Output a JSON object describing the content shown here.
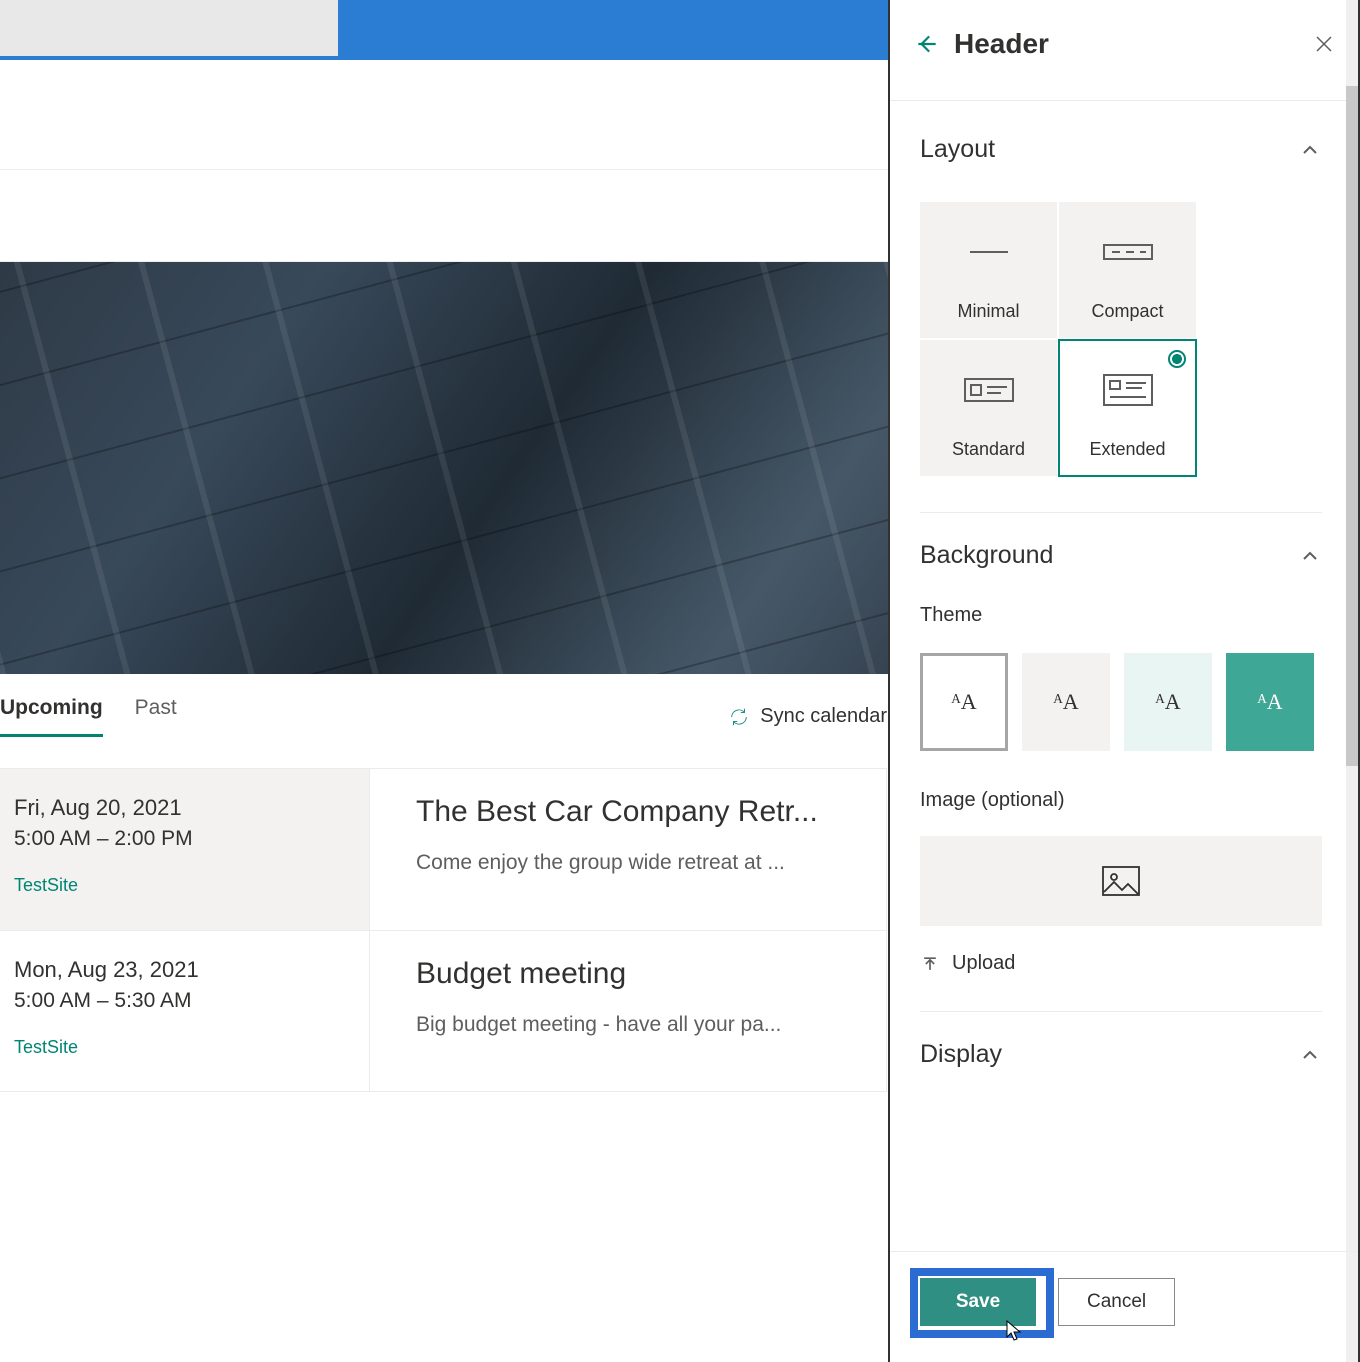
{
  "topbar": {
    "search_placeholder": ""
  },
  "tabs": {
    "upcoming": "Upcoming",
    "past": "Past"
  },
  "sync_label": "Sync calendar",
  "events": [
    {
      "date": "Fri, Aug 20, 2021",
      "time": "5:00 AM – 2:00 PM",
      "site": "TestSite",
      "title": "The Best Car Company Retr...",
      "desc": "Come enjoy the group wide retreat at ..."
    },
    {
      "date": "Mon, Aug 23, 2021",
      "time": "5:00 AM – 5:30 AM",
      "site": "TestSite",
      "title": "Budget meeting",
      "desc": "Big budget meeting - have all your pa..."
    }
  ],
  "panel": {
    "title": "Header",
    "sections": {
      "layout": {
        "title": "Layout",
        "options": {
          "minimal": "Minimal",
          "compact": "Compact",
          "standard": "Standard",
          "extended": "Extended"
        },
        "selected": "Extended"
      },
      "background": {
        "title": "Background",
        "theme_label": "Theme",
        "image_label": "Image (optional)",
        "upload_label": "Upload"
      },
      "display": {
        "title": "Display"
      }
    },
    "swatch_glyph": "ᴬA",
    "save": "Save",
    "cancel": "Cancel"
  },
  "colors": {
    "accent": "#008575",
    "brand_blue": "#2b7cd3"
  }
}
